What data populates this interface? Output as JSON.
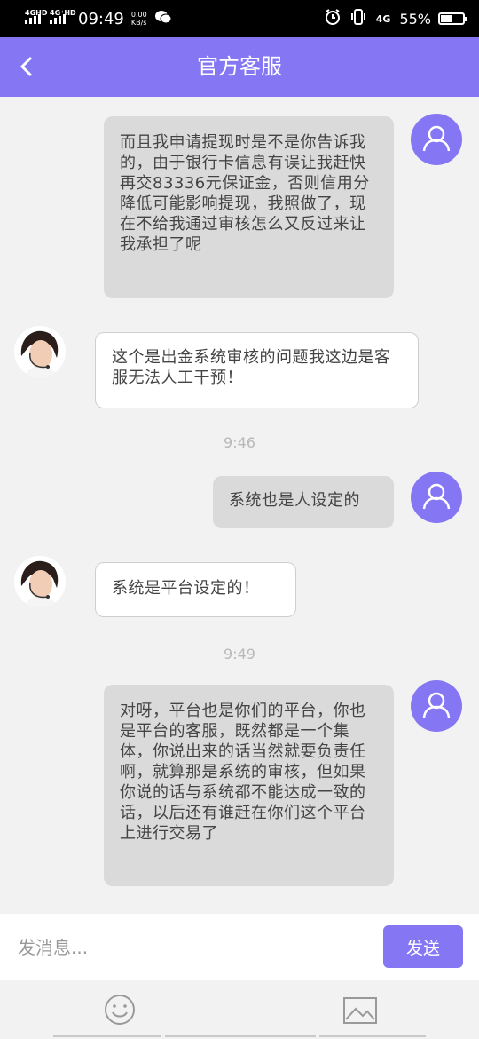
{
  "status_bar": {
    "sim1_label": "4GHD",
    "sim2_label": "4G⁺HD",
    "time": "09:49",
    "speed_value": "0.00",
    "speed_unit": "KB/s",
    "network_label": "4G",
    "battery_text": "55%",
    "battery_level_percent": 55
  },
  "header": {
    "title": "官方客服"
  },
  "messages": {
    "m1": {
      "text": "而且我申请提现时是不是你告诉我的，由于银行卡信息有误让我赶快再交83336元保证金，否则信用分降低可能影响提现，我照做了，现在不给我通过审核怎么又反过来让我承担了呢"
    },
    "m2": {
      "text": "这个是出金系统审核的问题我这边是客服无法人工干预！"
    },
    "t1": "9:46",
    "m3": {
      "text": "系统也是人设定的"
    },
    "m4": {
      "text": "系统是平台设定的！"
    },
    "t2": "9:49",
    "m5": {
      "text": "对呀，平台也是你们的平台，你也是平台的客服，既然都是一个集体，你说出来的话当然就要负责任啊，就算那是系统的审核，但如果你说的话与系统都不能达成一致的话，以后还有谁赶在你们这个平台上进行交易了"
    }
  },
  "composer": {
    "placeholder": "发消息...",
    "send_label": "发送"
  },
  "colors": {
    "accent": "#8577f4",
    "outgoing_bubble": "#dadada",
    "incoming_bubble": "#ffffff",
    "background": "#f2f2f2"
  }
}
